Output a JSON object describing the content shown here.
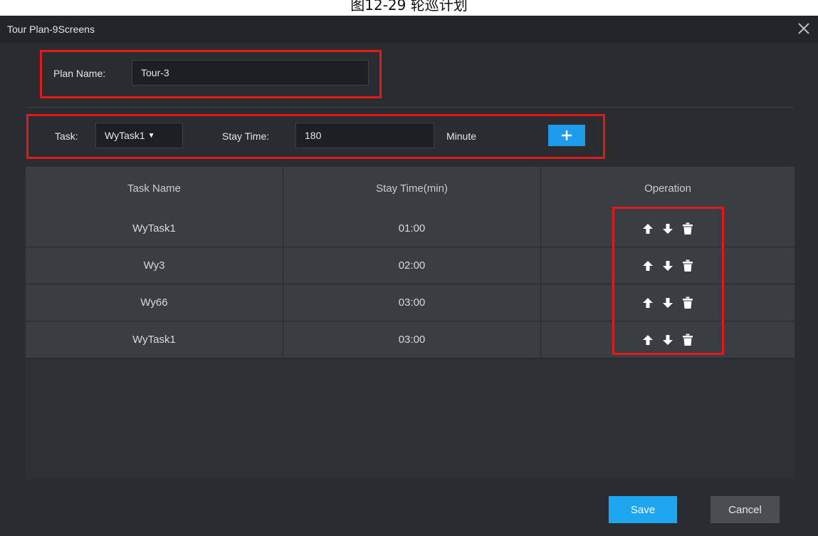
{
  "caption": "图12-29 轮巡计划",
  "window": {
    "title": "Tour Plan-9Screens"
  },
  "plan": {
    "label": "Plan Name:",
    "value": "Tour-3"
  },
  "task_bar": {
    "task_label": "Task:",
    "task_selected": "WyTask1",
    "stay_label": "Stay Time:",
    "stay_value": "180",
    "unit": "Minute",
    "add_icon": "plus-icon"
  },
  "table": {
    "columns": [
      "Task Name",
      "Stay Time(min)",
      "Operation"
    ],
    "rows": [
      {
        "name": "WyTask1",
        "stay": "01:00"
      },
      {
        "name": "Wy3",
        "stay": "02:00"
      },
      {
        "name": "Wy66",
        "stay": "03:00"
      },
      {
        "name": "WyTask1",
        "stay": "03:00"
      }
    ],
    "operation_icons": [
      "arrow-up-icon",
      "arrow-down-icon",
      "trash-icon"
    ]
  },
  "footer": {
    "save": "Save",
    "cancel": "Cancel"
  },
  "colors": {
    "accent": "#1ea7f0",
    "highlight": "#e01a1a",
    "background": "#2a2c30"
  }
}
